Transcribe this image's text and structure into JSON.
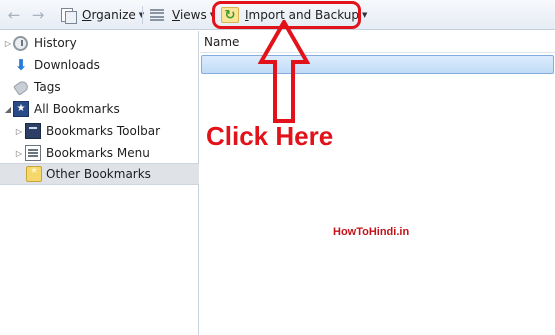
{
  "toolbar": {
    "back_icon": "back-arrow-icon",
    "forward_icon": "forward-arrow-icon",
    "organize": {
      "prefix": "",
      "underlined": "O",
      "rest": "rganize",
      "icon": "organize-icon"
    },
    "views": {
      "underlined": "V",
      "rest": "iews",
      "icon": "views-icon"
    },
    "import_backup": {
      "underlined": "I",
      "rest": "mport and Backup",
      "icon": "import-backup-icon"
    },
    "highlight_color": "#e2121a"
  },
  "sidebar": {
    "items": [
      {
        "label": "History",
        "icon": "history-clock-icon",
        "expandable": true
      },
      {
        "label": "Downloads",
        "icon": "downloads-arrow-icon",
        "expandable": false
      },
      {
        "label": "Tags",
        "icon": "tag-icon",
        "expandable": false
      },
      {
        "label": "All Bookmarks",
        "icon": "all-bookmarks-icon",
        "expandable": true,
        "expanded": true
      },
      {
        "label": "Bookmarks Toolbar",
        "icon": "bookmarks-toolbar-icon",
        "expandable": true
      },
      {
        "label": "Bookmarks Menu",
        "icon": "bookmarks-menu-icon",
        "expandable": true
      },
      {
        "label": "Other Bookmarks",
        "icon": "other-bookmarks-icon",
        "expandable": false,
        "selected": true
      }
    ]
  },
  "list": {
    "column_header": "Name"
  },
  "annotation": {
    "callout": "Click Here",
    "watermark": "HowToHindi.in",
    "color": "#e2121a"
  }
}
